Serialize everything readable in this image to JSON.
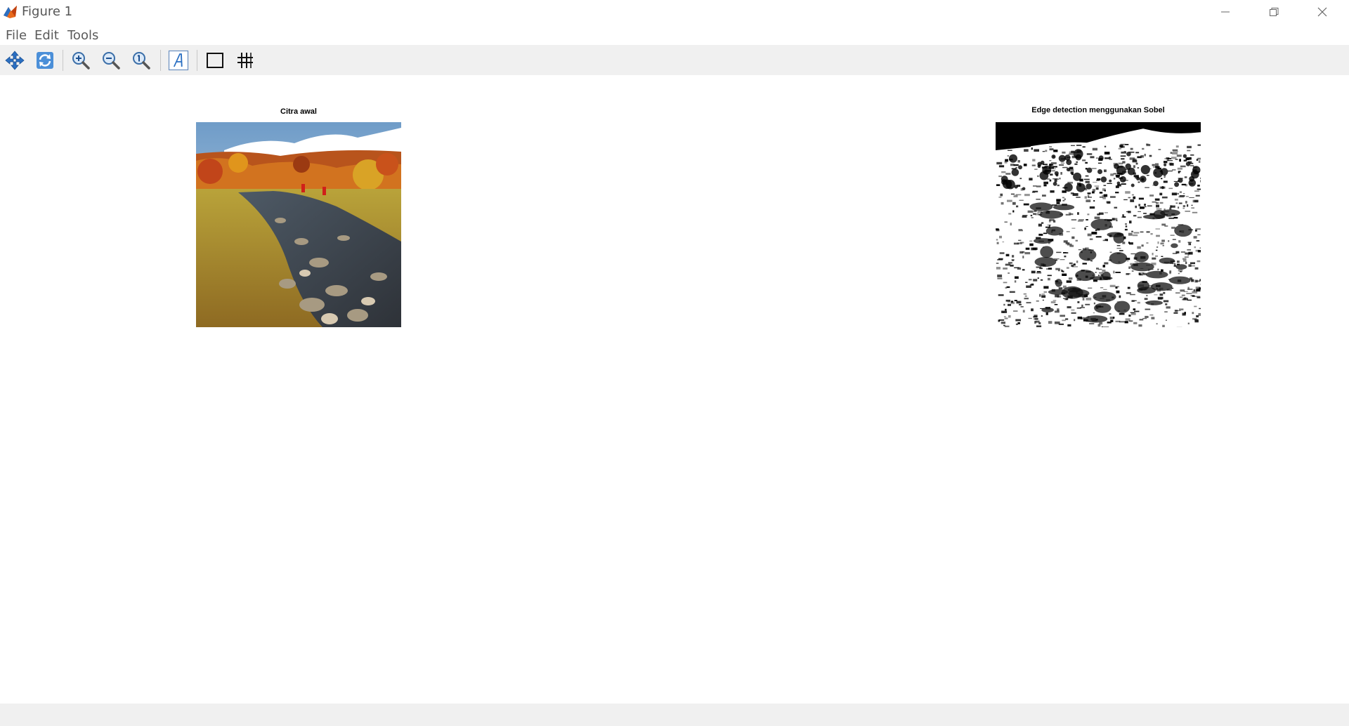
{
  "window": {
    "title": "Figure 1",
    "icons": {
      "app": "matlab-logo-icon",
      "minimize": "minimize-icon",
      "maximize": "restore-icon",
      "close": "close-icon"
    }
  },
  "menubar": {
    "items": [
      {
        "label": "File"
      },
      {
        "label": "Edit"
      },
      {
        "label": "Tools"
      }
    ]
  },
  "toolbar": {
    "tools": [
      {
        "icon": "pan-icon"
      },
      {
        "icon": "rotate-icon"
      },
      {
        "icon": "zoom-in-icon"
      },
      {
        "icon": "zoom-out-icon"
      },
      {
        "icon": "zoom-reset-icon"
      },
      {
        "icon": "text-annotation-icon"
      },
      {
        "icon": "rectangle-icon"
      },
      {
        "icon": "grid-icon"
      }
    ]
  },
  "figure": {
    "axes": [
      {
        "title": "Citra awal",
        "content": "original-color-photo"
      },
      {
        "title": "Edge detection menggunakan Sobel",
        "content": "sobel-edge-image"
      }
    ]
  },
  "colors": {
    "toolbar_bg": "#f0f0f0",
    "accent_blue": "#2a6fc2",
    "figure_bg": "#ffffff"
  }
}
